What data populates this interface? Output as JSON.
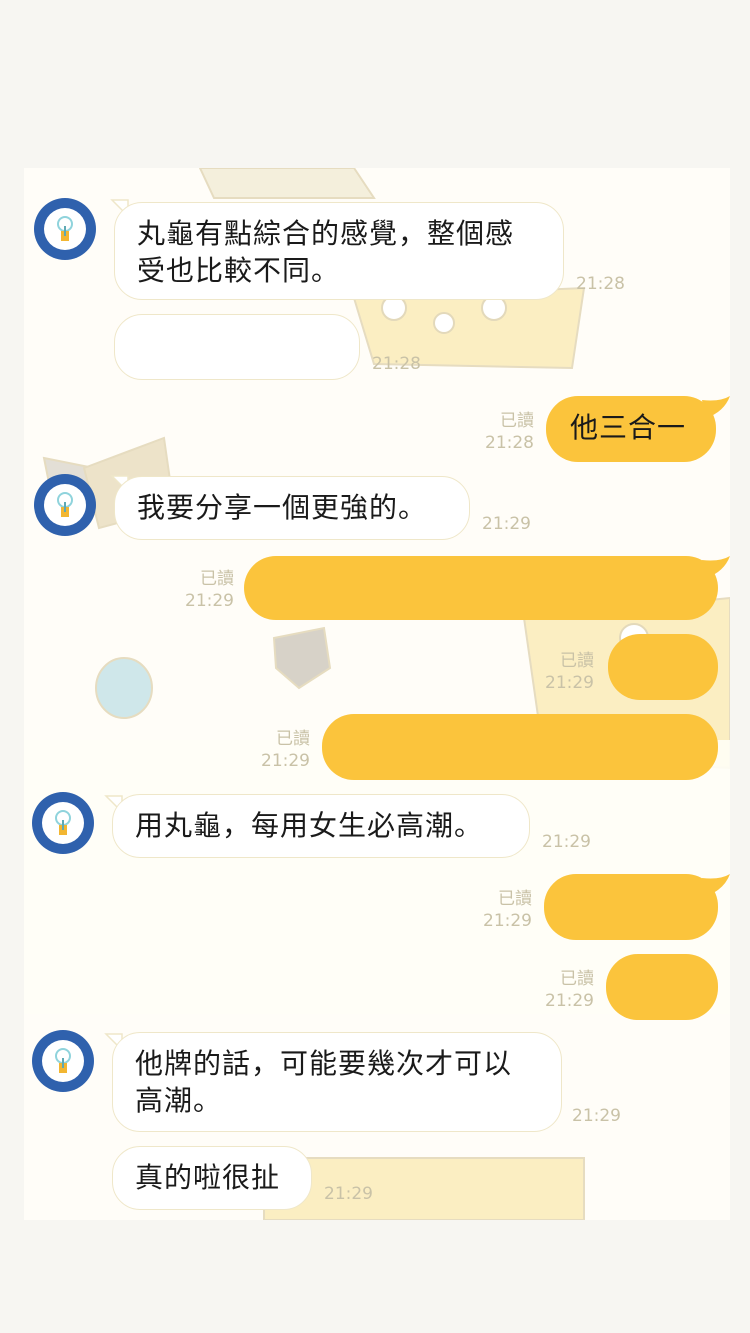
{
  "colors": {
    "outgoing_bubble": "#fbc43c",
    "incoming_bubble": "#ffffff",
    "avatar": "#2f61ad",
    "timestamp": "#c9c2a7"
  },
  "avatar_icon": "lightbulb-icon",
  "messages": [
    {
      "id": "m1",
      "direction": "in",
      "text": "丸龜有點綜合的感覺，整個感受也比較不同。",
      "time": "21:28"
    },
    {
      "id": "m2",
      "direction": "in",
      "text": "",
      "time": "21:28",
      "redacted": true
    },
    {
      "id": "m3",
      "direction": "out",
      "text": "他三合一",
      "read": "已讀",
      "time": "21:28"
    },
    {
      "id": "m4",
      "direction": "in",
      "text": "我要分享一個更強的。",
      "time": "21:29"
    },
    {
      "id": "m5",
      "direction": "out",
      "text": "",
      "read": "已讀",
      "time": "21:29",
      "redacted": true
    },
    {
      "id": "m6",
      "direction": "out",
      "text": "",
      "read": "已讀",
      "time": "21:29",
      "redacted": true
    },
    {
      "id": "m7",
      "direction": "out",
      "text": "",
      "read": "已讀",
      "time": "21:29",
      "redacted": true
    },
    {
      "id": "m8",
      "direction": "in",
      "text": "用丸龜，每用女生必高潮。",
      "time": "21:29"
    },
    {
      "id": "m9",
      "direction": "out",
      "text": "",
      "read": "已讀",
      "time": "21:29",
      "redacted": true
    },
    {
      "id": "m10",
      "direction": "out",
      "text": "",
      "read": "已讀",
      "time": "21:29",
      "redacted": true
    },
    {
      "id": "m11",
      "direction": "in",
      "text": "他牌的話，可能要幾次才可以高潮。",
      "time": "21:29"
    },
    {
      "id": "m12",
      "direction": "in",
      "text": "真的啦很扯",
      "time": "21:29"
    }
  ]
}
